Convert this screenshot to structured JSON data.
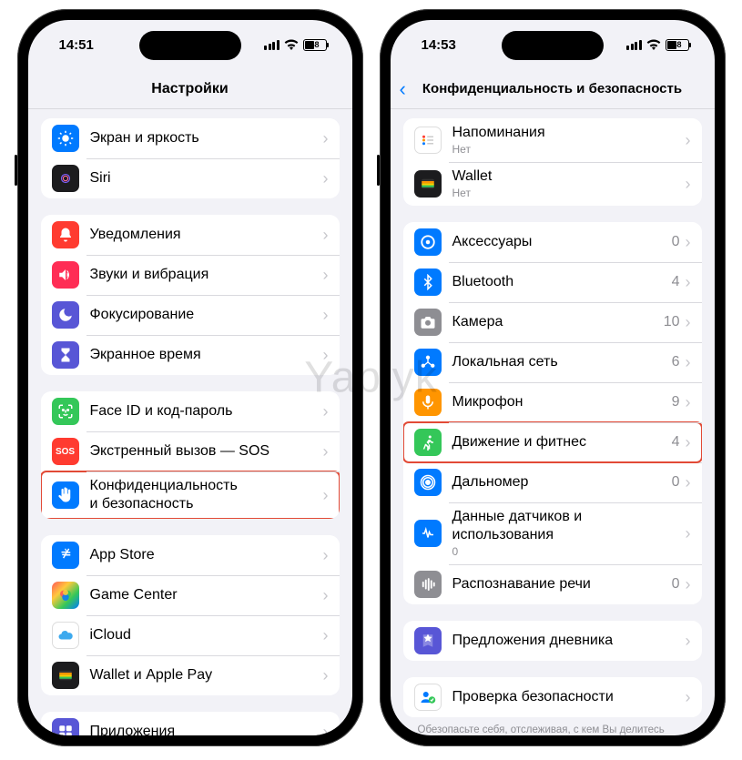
{
  "watermark": "Yablyk",
  "left": {
    "time": "14:51",
    "battery": "48",
    "title": "Настройки",
    "groups": [
      {
        "first": true,
        "rows": [
          {
            "icon": "display-icon",
            "bg": "bg-blue",
            "label": "Экран и яркость"
          },
          {
            "icon": "siri-icon",
            "bg": "bg-black",
            "label": "Siri"
          }
        ]
      },
      {
        "rows": [
          {
            "icon": "bell-icon",
            "bg": "bg-red",
            "label": "Уведомления"
          },
          {
            "icon": "sound-icon",
            "bg": "bg-pink",
            "label": "Звуки и вибрация"
          },
          {
            "icon": "moon-icon",
            "bg": "bg-purple",
            "label": "Фокусирование"
          },
          {
            "icon": "hourglass-icon",
            "bg": "bg-purple",
            "label": "Экранное время"
          }
        ]
      },
      {
        "rows": [
          {
            "icon": "faceid-icon",
            "bg": "bg-green",
            "label": "Face ID и код-пароль"
          },
          {
            "icon": "sos-icon",
            "bg": "bg-red",
            "label": "Экстренный вызов — SOS",
            "text": "SOS"
          },
          {
            "icon": "hand-icon",
            "bg": "bg-blue",
            "label": "Конфиденциальность и безопасность",
            "highlight": true,
            "multiline": "Конфиденциальность\nи безопасность"
          }
        ]
      },
      {
        "rows": [
          {
            "icon": "appstore-icon",
            "bg": "bg-blue",
            "label": "App Store"
          },
          {
            "icon": "gamecenter-icon",
            "bg": "bg-grad",
            "label": "Game Center"
          },
          {
            "icon": "icloud-icon",
            "bg": "bg-white",
            "label": "iCloud"
          },
          {
            "icon": "wallet-icon",
            "bg": "bg-black",
            "label": "Wallet и Apple Pay"
          }
        ]
      },
      {
        "rows": [
          {
            "icon": "apps-icon",
            "bg": "bg-purple",
            "label": "Приложения"
          }
        ]
      }
    ]
  },
  "right": {
    "time": "14:53",
    "battery": "48",
    "title": "Конфиденциальность и безопасность",
    "groups": [
      {
        "first": true,
        "rows": [
          {
            "icon": "reminders-icon",
            "bg": "bg-white",
            "label": "Напоминания",
            "sub": "Нет"
          },
          {
            "icon": "wallet-icon",
            "bg": "bg-black",
            "label": "Wallet",
            "sub": "Нет"
          }
        ]
      },
      {
        "rows": [
          {
            "icon": "accessory-icon",
            "bg": "bg-blue",
            "label": "Аксессуары",
            "detail": "0"
          },
          {
            "icon": "bluetooth-icon",
            "bg": "bg-blue",
            "label": "Bluetooth",
            "detail": "4"
          },
          {
            "icon": "camera-icon",
            "bg": "bg-gray",
            "label": "Камера",
            "detail": "10"
          },
          {
            "icon": "network-icon",
            "bg": "bg-blue",
            "label": "Локальная сеть",
            "detail": "6"
          },
          {
            "icon": "mic-icon",
            "bg": "bg-orange",
            "label": "Микрофон",
            "detail": "9"
          },
          {
            "icon": "fitness-icon",
            "bg": "bg-green",
            "label": "Движение и фитнес",
            "detail": "4",
            "highlight": true
          },
          {
            "icon": "nearby-icon",
            "bg": "bg-blue",
            "label": "Дальномер",
            "detail": "0"
          },
          {
            "icon": "sensor-icon",
            "bg": "bg-blue",
            "label": "Данные датчиков и использования",
            "sub": "0"
          },
          {
            "icon": "speech-icon",
            "bg": "bg-gray",
            "label": "Распознавание речи",
            "detail": "0"
          }
        ]
      },
      {
        "rows": [
          {
            "icon": "journal-icon",
            "bg": "bg-purple",
            "label": "Предложения дневника"
          }
        ]
      },
      {
        "rows": [
          {
            "icon": "safety-icon",
            "bg": "bg-white",
            "label": "Проверка безопасности"
          }
        ],
        "footer": "Обезопасьте себя, отслеживая, с кем Вы делитесь своей информацией и какие приложения и устройства имеют к ней доступ."
      }
    ]
  }
}
